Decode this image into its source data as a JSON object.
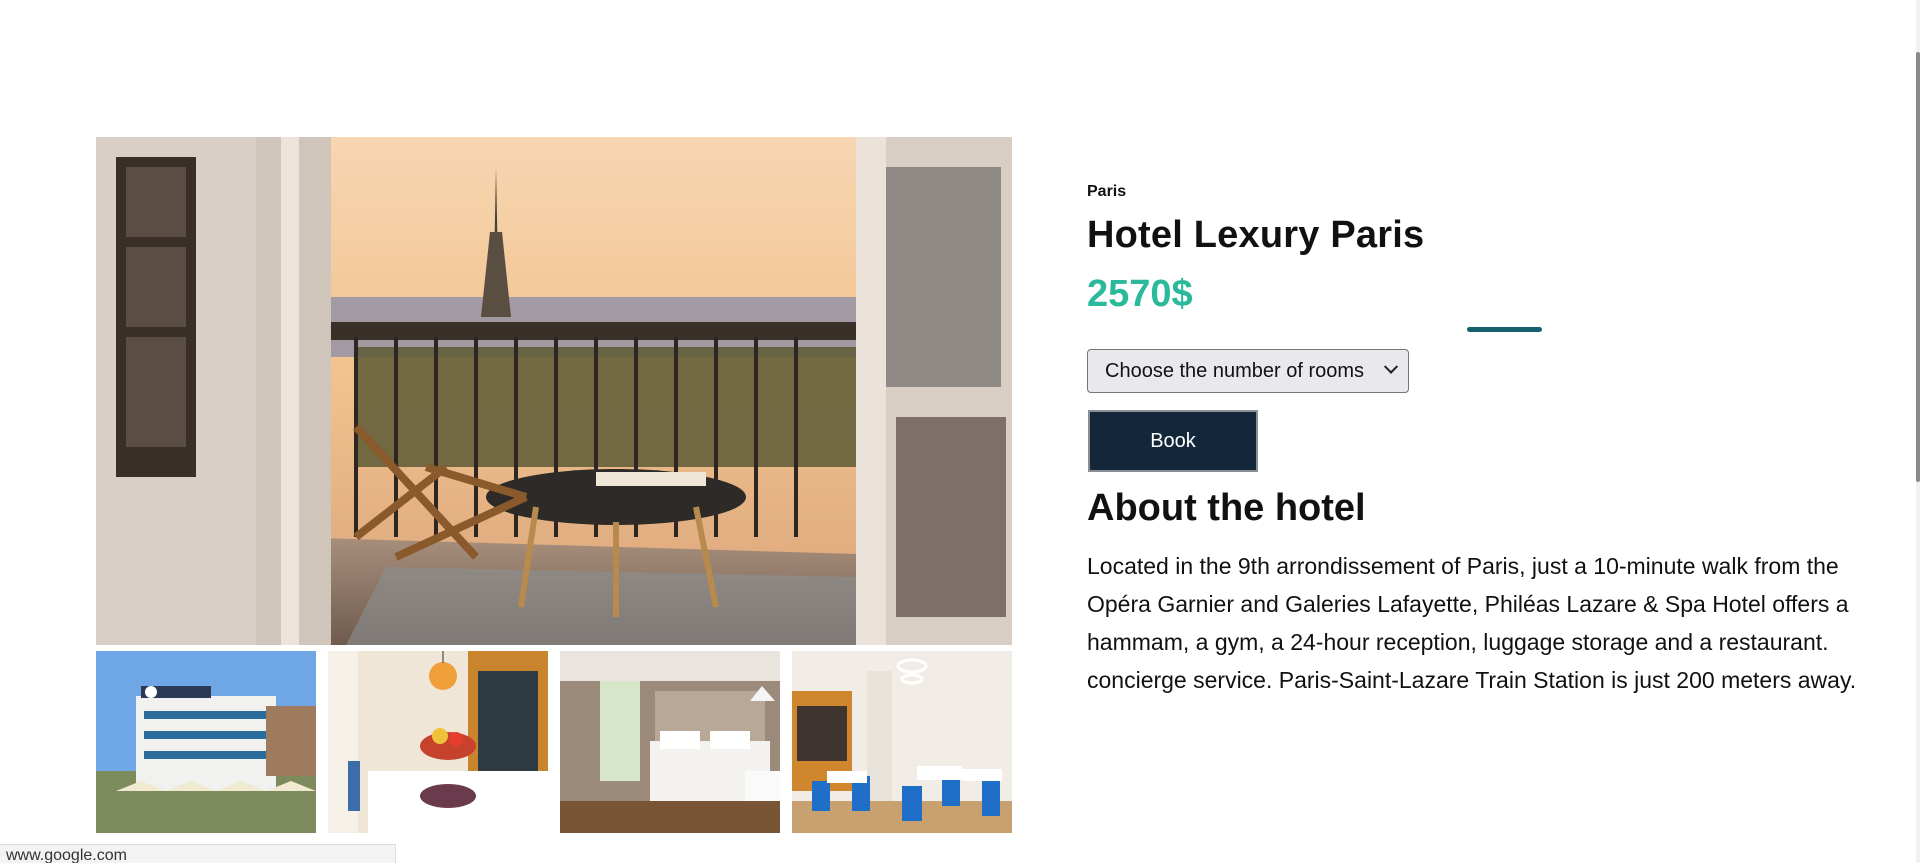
{
  "hotel": {
    "city": "Paris",
    "name": "Hotel Lexury Paris",
    "price": "2570$",
    "price_color": "#2ab99a"
  },
  "booking": {
    "rooms_select_value": "Choose the number of rooms",
    "book_label": "Book",
    "book_bg_color": "#14263a"
  },
  "about": {
    "heading": "About the hotel",
    "text": "Located in the 9th arrondissement of Paris, just a 10-minute walk from the Opéra Garnier and Galeries Lafayette, Philéas Lazare & Spa Hotel offers a hammam, a gym, a 24-hour reception, luggage storage and a restaurant. concierge service. Paris-Saint-Lazare Train Station is just 200 meters away."
  },
  "gallery": {
    "main_photo": "balcony-eiffel-view-photo",
    "thumbnails": [
      "hotel-exterior-photo",
      "lobby-bar-photo",
      "bedroom-photo",
      "restaurant-photo"
    ]
  },
  "status_bar": {
    "url": "www.google.com"
  }
}
